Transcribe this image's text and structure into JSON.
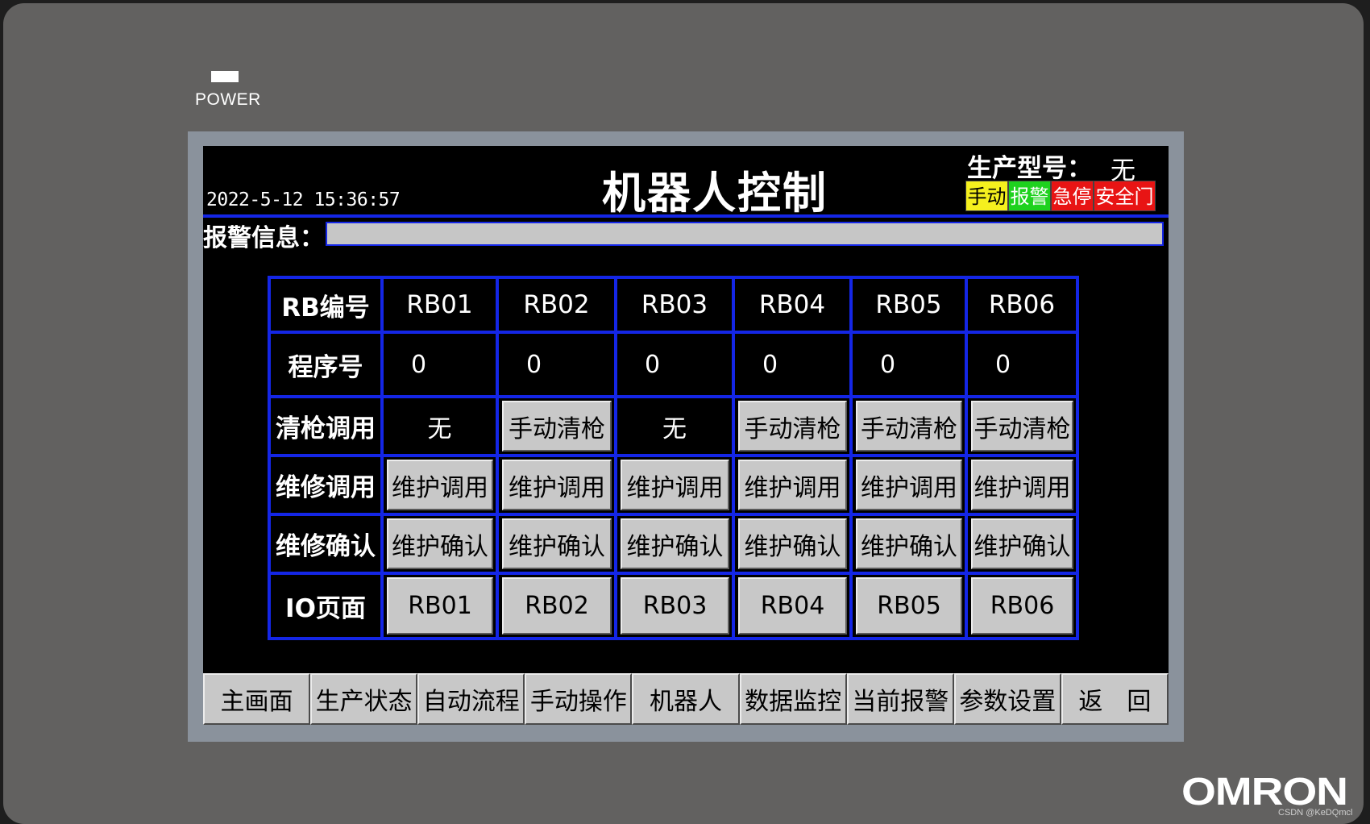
{
  "device": {
    "power_label": "POWER",
    "brand": "OMRON",
    "watermark": "CSDN @KeDQmcl"
  },
  "header": {
    "datetime": "2022-5-12 15:36:57",
    "title": "机器人控制",
    "model_label": "生产型号：",
    "model_value": "无",
    "status_badges": [
      {
        "label": "手动",
        "color": "#f5f01e"
      },
      {
        "label": "报警",
        "color": "#1ed21e"
      },
      {
        "label": "急停",
        "color": "#e81414"
      },
      {
        "label": "安全门",
        "color": "#e81414"
      }
    ]
  },
  "alarm": {
    "label": "报警信息：",
    "message": ""
  },
  "table": {
    "columns": [
      "RB编号",
      "RB01",
      "RB02",
      "RB03",
      "RB04",
      "RB05",
      "RB06"
    ],
    "program_label": "程序号",
    "program_numbers": [
      "0",
      "0",
      "0",
      "0",
      "0",
      "0"
    ],
    "gun_clean_label": "清枪调用",
    "gun_clean": [
      "无",
      "手动清枪",
      "无",
      "手动清枪",
      "手动清枪",
      "手动清枪"
    ],
    "maint_call_label": "维修调用",
    "maint_call": [
      "维护调用",
      "维护调用",
      "维护调用",
      "维护调用",
      "维护调用",
      "维护调用"
    ],
    "maint_confirm_label": "维修确认",
    "maint_confirm": [
      "维护确认",
      "维护确认",
      "维护确认",
      "维护确认",
      "维护确认",
      "维护确认"
    ],
    "io_label": "IO页面",
    "io_pages": [
      "RB01",
      "RB02",
      "RB03",
      "RB04",
      "RB05",
      "RB06"
    ]
  },
  "nav": [
    "主画面",
    "生产状态",
    "自动流程",
    "手动操作",
    "机器人",
    "数据监控",
    "当前报警",
    "参数设置",
    "返　回"
  ]
}
